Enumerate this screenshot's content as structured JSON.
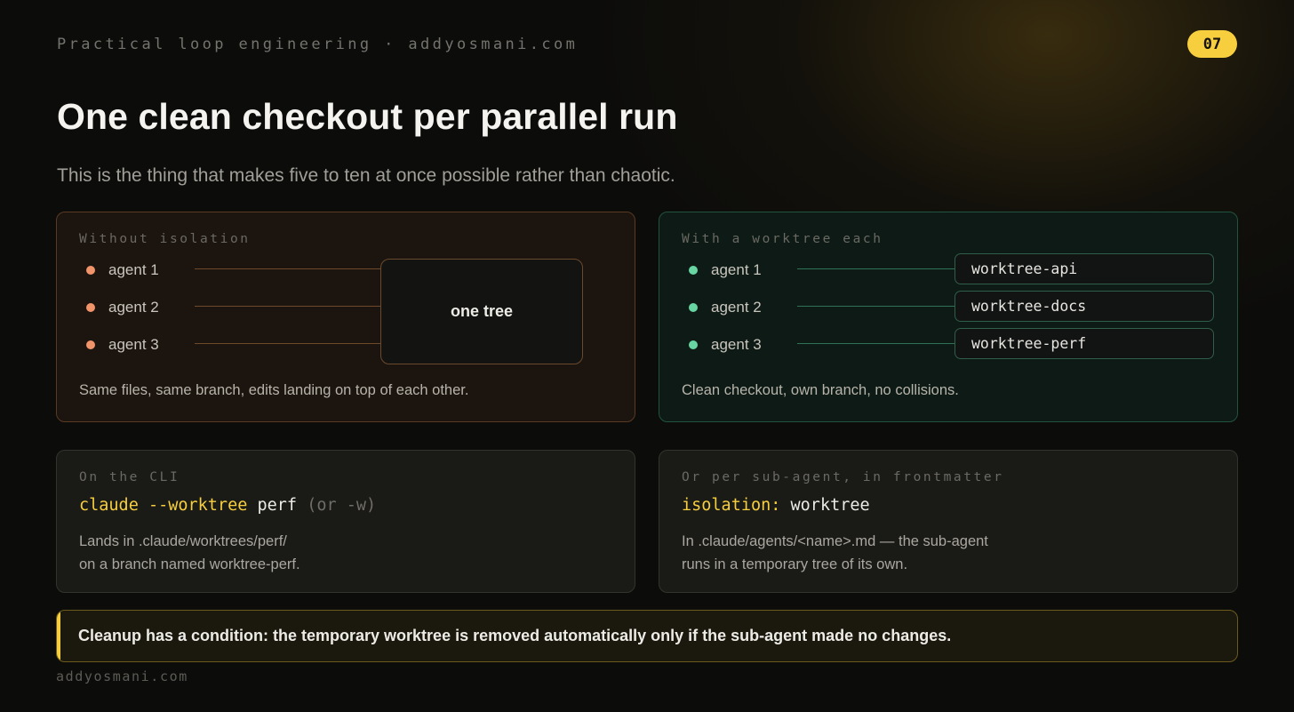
{
  "header": {
    "kicker": "Practical loop engineering · addyosmani.com",
    "slide_number": "07"
  },
  "title": "One clean checkout per parallel run",
  "subtitle": "This is the thing that makes five to ten at once possible rather than chaotic.",
  "without_isolation": {
    "label": "Without isolation",
    "agents": [
      "agent 1",
      "agent 2",
      "agent 3"
    ],
    "tree_label": "one tree",
    "caption": "Same files, same branch, edits landing on top of each other."
  },
  "with_worktree": {
    "label": "With a worktree each",
    "agents": [
      "agent 1",
      "agent 2",
      "agent 3"
    ],
    "worktrees": [
      "worktree-api",
      "worktree-docs",
      "worktree-perf"
    ],
    "caption": "Clean checkout, own branch, no collisions."
  },
  "cli": {
    "label": "On the CLI",
    "command": "claude --worktree",
    "argument": "perf",
    "alias": "(or -w)",
    "desc_line1": "Lands in .claude/worktrees/perf/",
    "desc_line2": "on a branch named worktree-perf."
  },
  "frontmatter": {
    "label": "Or per sub-agent, in frontmatter",
    "key": "isolation:",
    "value": "worktree",
    "desc_line1": "In .claude/agents/<name>.md — the sub-agent",
    "desc_line2": "runs in a temporary tree of its own."
  },
  "callout": "Cleanup has a condition: the temporary worktree is removed automatically only if the sub-agent made no changes.",
  "footer": "addyosmani.com",
  "colors": {
    "accent_yellow": "#f7cf3e",
    "agent_orange": "#f1946a",
    "agent_green": "#67d6a3"
  }
}
